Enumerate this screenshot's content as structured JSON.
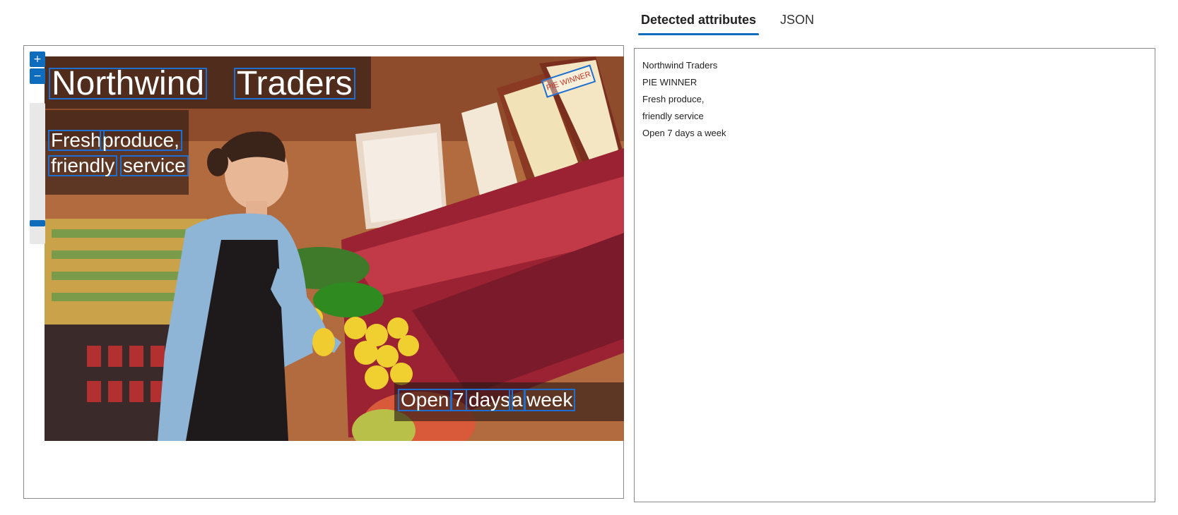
{
  "tabs": [
    {
      "label": "Detected attributes",
      "active": true
    },
    {
      "label": "JSON",
      "active": false
    }
  ],
  "zoom": {
    "in_symbol": "+",
    "out_symbol": "−"
  },
  "image": {
    "title_words": [
      "Northwind",
      "Traders"
    ],
    "tagline_line1": [
      "Fresh",
      "produce,"
    ],
    "tagline_line2": [
      "friendly",
      "service"
    ],
    "hours_words": [
      "Open",
      "7",
      "days",
      "a",
      "week"
    ],
    "sign_text": "PIE WINNER"
  },
  "detected_attributes": [
    "Northwind Traders",
    "PIE WINNER",
    "Fresh produce,",
    "friendly service",
    "Open 7 days a week"
  ],
  "colors": {
    "accent": "#0f6cbd",
    "box": "#1e6fd0"
  }
}
